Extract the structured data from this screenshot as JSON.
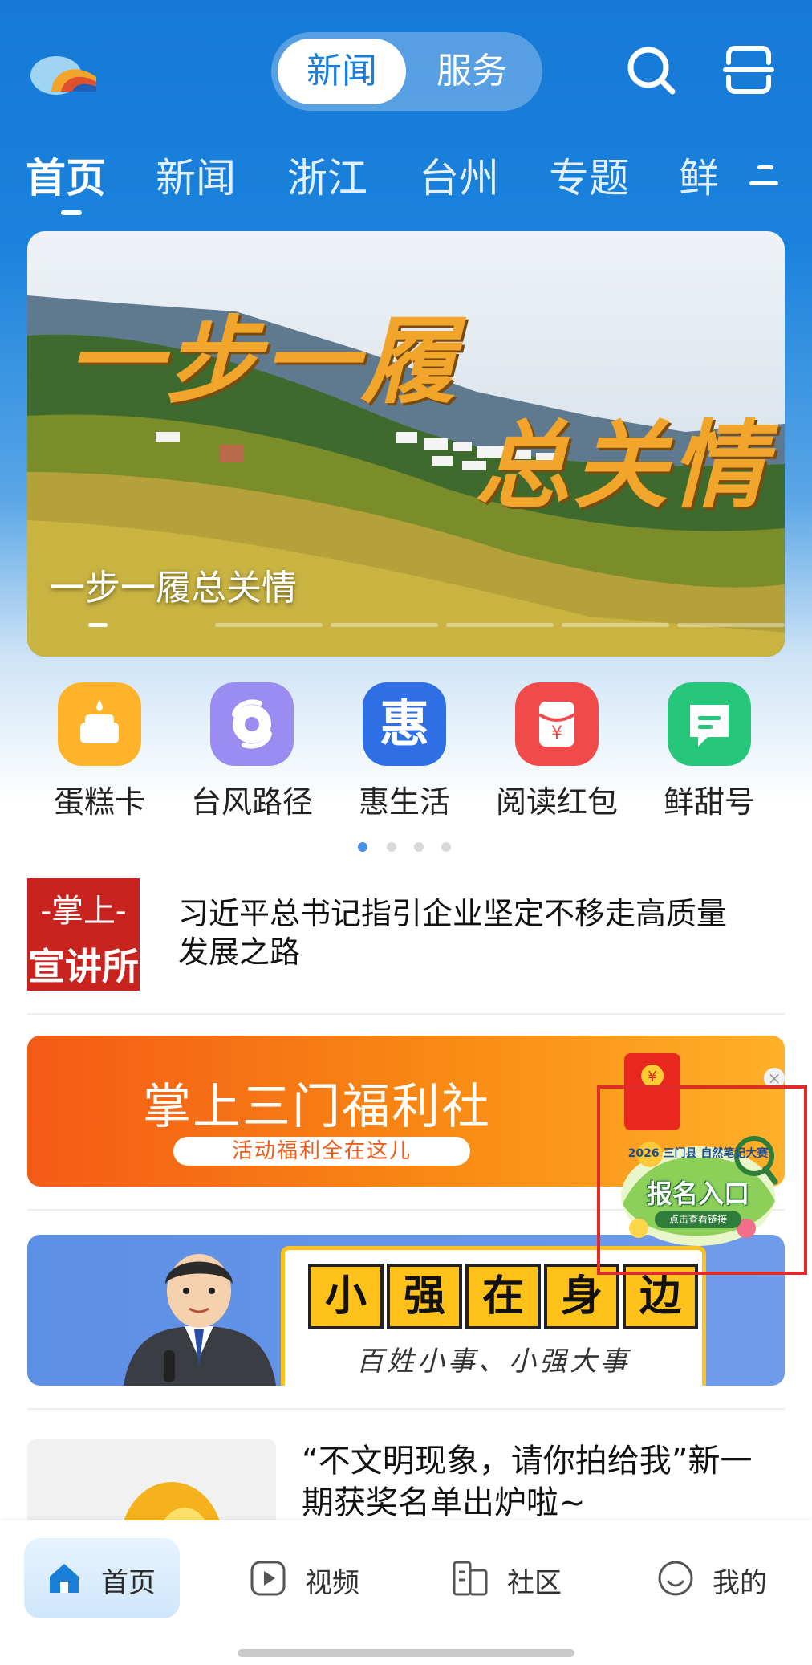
{
  "header": {
    "segment": {
      "active": "新闻",
      "inactive": "服务"
    },
    "icons": [
      "app-logo-icon",
      "search-icon",
      "scan-icon"
    ]
  },
  "tabs": [
    {
      "label": "首页",
      "active": true
    },
    {
      "label": "新闻"
    },
    {
      "label": "浙江"
    },
    {
      "label": "台州"
    },
    {
      "label": "专题"
    },
    {
      "label": "鲜"
    }
  ],
  "banner": {
    "headline_line1": "一步一履",
    "headline_line2": "总关情",
    "caption": "一步一履总关情",
    "slide_count": 6,
    "active_slide": 1
  },
  "quick_actions": [
    {
      "label": "蛋糕卡",
      "icon": "cake-icon",
      "color": "#ffb32b"
    },
    {
      "label": "台风路径",
      "icon": "typhoon-icon",
      "color": "#9a8cf0"
    },
    {
      "label": "惠生活",
      "icon": "hui-icon",
      "color": "#2f6fe6",
      "glyph": "惠"
    },
    {
      "label": "阅读红包",
      "icon": "red-envelope-icon",
      "color": "#f04a4a"
    },
    {
      "label": "鲜甜号",
      "icon": "message-icon",
      "color": "#26c77a"
    }
  ],
  "quick_pages": {
    "count": 4,
    "active": 1
  },
  "feed": {
    "item1": {
      "badge_line1": "-掌上-",
      "badge_line2": "宣讲所",
      "title": "习近平总书记指引企业坚定不移走高质量发展之路"
    },
    "ad1": {
      "title": "掌上三门福利社",
      "subtitle": "活动福利全在这儿",
      "close": "×"
    },
    "promo": {
      "top": "2026 三门县 自然笔记大赛",
      "main": "报名入口",
      "button": "点击查看链接"
    },
    "ad2": {
      "tiles": [
        "小",
        "强",
        "在",
        "身",
        "边"
      ],
      "subtitle": "百姓小事、小强大事"
    },
    "item2": {
      "title": "“不文明现象，请你拍给我”新一期获奖名单出炉啦~"
    }
  },
  "bottom_nav": [
    {
      "label": "首页",
      "icon": "home-icon",
      "active": true
    },
    {
      "label": "视频",
      "icon": "video-icon"
    },
    {
      "label": "社区",
      "icon": "community-icon"
    },
    {
      "label": "我的",
      "icon": "profile-icon"
    }
  ],
  "colors": {
    "primary": "#1a7fd8",
    "highlight_frame": "#e02b2b"
  }
}
